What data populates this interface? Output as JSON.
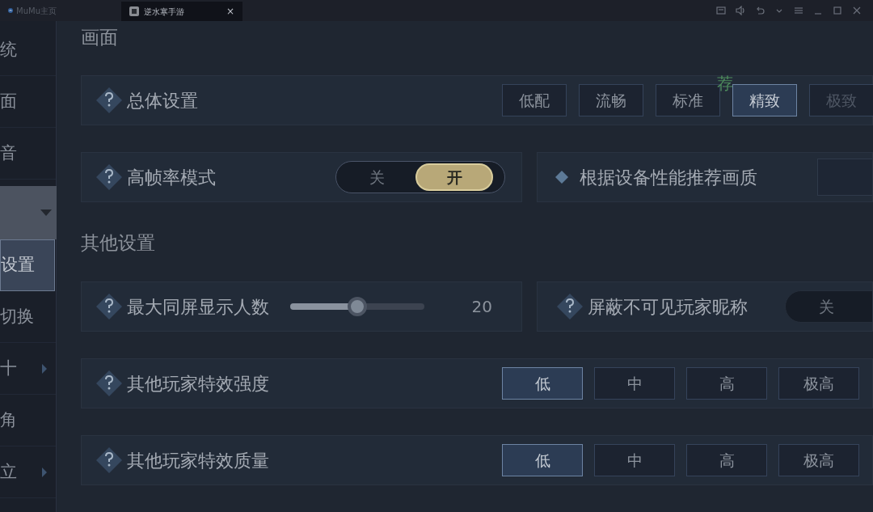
{
  "title_bar": {
    "tabs": [
      {
        "label": "MuMu主页",
        "selected": false
      },
      {
        "label": "逆水寒手游",
        "selected": true,
        "close": "×"
      }
    ]
  },
  "sidebar": {
    "items": [
      {
        "label": "统",
        "selected": false
      },
      {
        "label": "面",
        "selected": false
      },
      {
        "label": "音",
        "selected": false
      },
      {
        "expanded": true,
        "children": [
          {
            "label": "设置",
            "selected": true
          },
          {
            "label": "切换",
            "selected": false
          },
          {
            "label": "十",
            "selected": false,
            "arrow": true
          },
          {
            "label": "角",
            "selected": false
          },
          {
            "label": "立",
            "selected": false,
            "arrow": true
          }
        ]
      }
    ]
  },
  "sections": [
    {
      "title": "画面",
      "rows": [
        {
          "cards": [
            {
              "kind": "options",
              "label": "总体设置",
              "options": [
                {
                  "label": "低配",
                  "selected": false,
                  "disabled": false
                },
                {
                  "label": "流畅",
                  "selected": false,
                  "disabled": false
                },
                {
                  "label": "标准",
                  "selected": false,
                  "disabled": false,
                  "badge": "荐"
                },
                {
                  "label": "精致",
                  "selected": true,
                  "disabled": false
                },
                {
                  "label": "极致",
                  "selected": false,
                  "disabled": true
                }
              ]
            }
          ]
        },
        {
          "cards": [
            {
              "kind": "toggle",
              "label": "高帧率模式",
              "on": true,
              "options": [
                {
                  "label": "关"
                },
                {
                  "label": "开"
                }
              ]
            },
            {
              "kind": "action",
              "label": "根据设备性能推荐画质"
            }
          ]
        }
      ]
    },
    {
      "title": "其他设置",
      "rows": [
        {
          "cards": [
            {
              "kind": "slider",
              "label": "最大同屏显示人数",
              "level": 0.5,
              "reading": "20"
            },
            {
              "kind": "toggle",
              "label": "屏蔽不可见玩家昵称",
              "on": false,
              "options": [
                {
                  "label": "关"
                }
              ]
            }
          ]
        },
        {
          "cards": [
            {
              "kind": "options",
              "label": "其他玩家特效强度",
              "options": [
                {
                  "label": "低",
                  "selected": true
                },
                {
                  "label": "中",
                  "selected": false
                },
                {
                  "label": "高",
                  "selected": false
                },
                {
                  "label": "极高",
                  "selected": false
                }
              ]
            }
          ]
        },
        {
          "cards": [
            {
              "kind": "options",
              "label": "其他玩家特效质量",
              "options": [
                {
                  "label": "低",
                  "selected": true
                },
                {
                  "label": "中",
                  "selected": false
                },
                {
                  "label": "高",
                  "selected": false
                },
                {
                  "label": "极高",
                  "selected": false
                }
              ]
            }
          ]
        }
      ]
    }
  ]
}
